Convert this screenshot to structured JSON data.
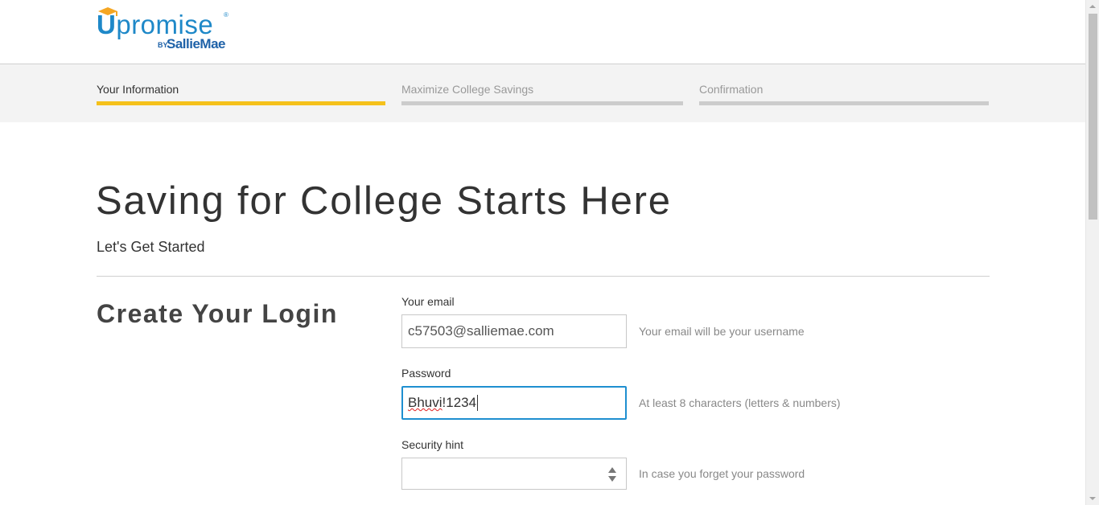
{
  "brand": {
    "name_u": "U",
    "name_rest": "promise",
    "registered": "®",
    "by": "BY",
    "partner": "SallieMae",
    "brand_color": "#1e88c8",
    "partner_color": "#1f62a8"
  },
  "steps": [
    {
      "label": "Your Information",
      "active": true
    },
    {
      "label": "Maximize College Savings",
      "active": false
    },
    {
      "label": "Confirmation",
      "active": false
    }
  ],
  "colors": {
    "active_step": "#f5c11b",
    "inactive_step": "#cccccc",
    "focus": "#1e8fd0"
  },
  "main": {
    "title": "Saving for College Starts Here",
    "subtitle": "Let's Get Started"
  },
  "login": {
    "section_title": "Create Your Login",
    "email": {
      "label": "Your email",
      "value": "c57503@salliemae.com",
      "hint": "Your email will be your username"
    },
    "password": {
      "label": "Password",
      "value_misspelled": "Bhuvi",
      "value_rest": "!1234",
      "hint": "At least 8 characters (letters & numbers)"
    },
    "security_hint": {
      "label": "Security hint",
      "value": "",
      "hint": "In case you forget your password"
    }
  }
}
